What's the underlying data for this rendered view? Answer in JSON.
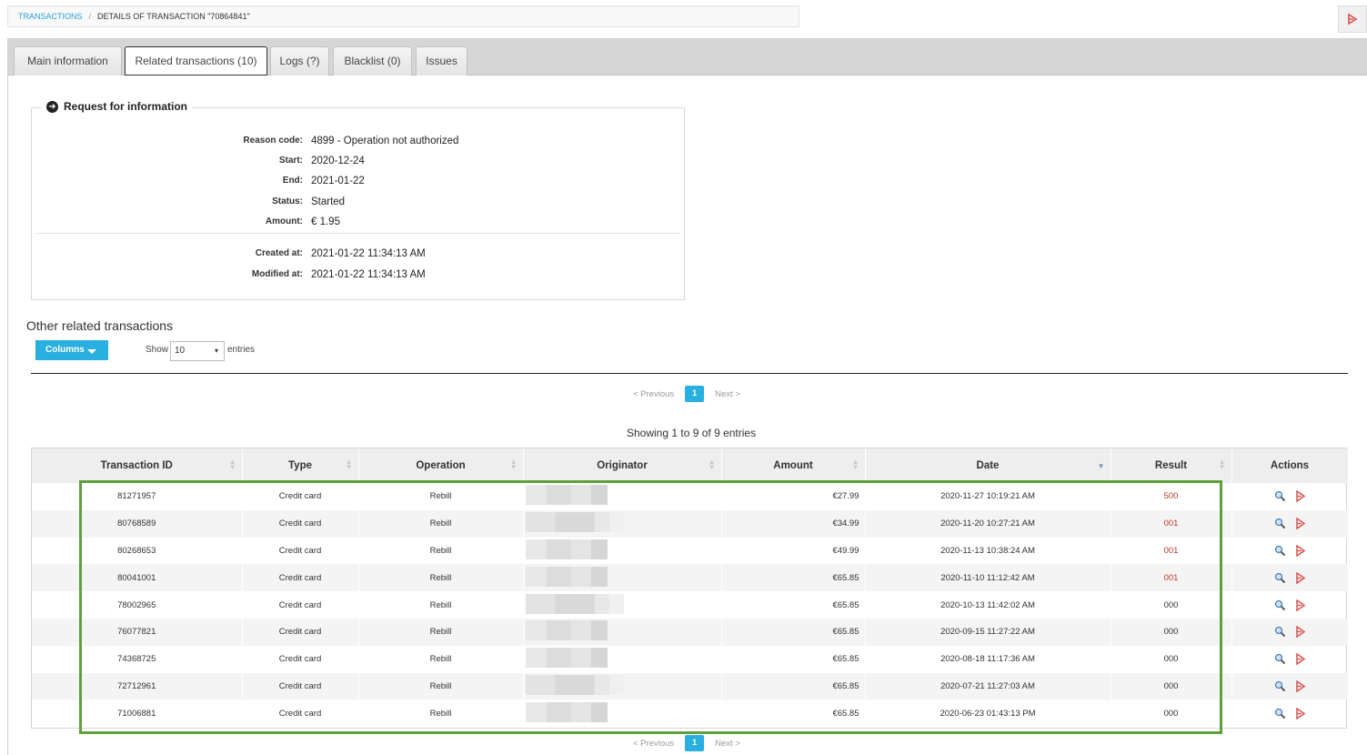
{
  "breadcrumb": {
    "root": "TRANSACTIONS",
    "separator": "/",
    "current": "DETAILS OF TRANSACTION \"70864841\""
  },
  "tabs": [
    {
      "label": "Main information"
    },
    {
      "label": "Related transactions (10)",
      "active": true
    },
    {
      "label": "Logs (?)"
    },
    {
      "label": "Blacklist (0)"
    },
    {
      "label": "Issues"
    }
  ],
  "request_info": {
    "legend": "Request for information",
    "fields": [
      {
        "label": "Reason code:",
        "value": "4899 - Operation not authorized"
      },
      {
        "label": "Start:",
        "value": "2020-12-24"
      },
      {
        "label": "End:",
        "value": "2021-01-22"
      },
      {
        "label": "Status:",
        "value": "Started"
      },
      {
        "label": "Amount:",
        "value": "€ 1.95"
      }
    ],
    "meta": [
      {
        "label": "Created at:",
        "value": "2021-01-22 11:34:13 AM"
      },
      {
        "label": "Modified at:",
        "value": "2021-01-22 11:34:13 AM"
      }
    ]
  },
  "related": {
    "title": "Other related transactions",
    "columns_button": "Columns",
    "show_label": "Show",
    "show_value": "10",
    "entries_label": "entries",
    "pager": {
      "previous": "< Previous",
      "page": "1",
      "next": "Next >"
    },
    "showing": "Showing 1 to 9 of 9 entries",
    "headers": [
      "Transaction ID",
      "Type",
      "Operation",
      "Originator",
      "Amount",
      "Date",
      "Result",
      "Actions"
    ],
    "rows": [
      {
        "id": "81271957",
        "type": "Credit card",
        "operation": "Rebill",
        "amount": "€27.99",
        "date": "2020-11-27 10:19:21 AM",
        "result": "500"
      },
      {
        "id": "80768589",
        "type": "Credit card",
        "operation": "Rebill",
        "amount": "€34.99",
        "date": "2020-11-20 10:27:21 AM",
        "result": "001"
      },
      {
        "id": "80268653",
        "type": "Credit card",
        "operation": "Rebill",
        "amount": "€49.99",
        "date": "2020-11-13 10:38:24 AM",
        "result": "001"
      },
      {
        "id": "80041001",
        "type": "Credit card",
        "operation": "Rebill",
        "amount": "€65.85",
        "date": "2020-11-10 11:12:42 AM",
        "result": "001"
      },
      {
        "id": "78002965",
        "type": "Credit card",
        "operation": "Rebill",
        "amount": "€65.85",
        "date": "2020-10-13 11:42:02 AM",
        "result": "000"
      },
      {
        "id": "76077821",
        "type": "Credit card",
        "operation": "Rebill",
        "amount": "€65.85",
        "date": "2020-09-15 11:27:22 AM",
        "result": "000"
      },
      {
        "id": "74368725",
        "type": "Credit card",
        "operation": "Rebill",
        "amount": "€65.85",
        "date": "2020-08-18 11:17:36 AM",
        "result": "000"
      },
      {
        "id": "72712961",
        "type": "Credit card",
        "operation": "Rebill",
        "amount": "€65.85",
        "date": "2020-07-21 11:27:03 AM",
        "result": "000"
      },
      {
        "id": "71006881",
        "type": "Credit card",
        "operation": "Rebill",
        "amount": "€65.85",
        "date": "2020-06-23 01:43:13 PM",
        "result": "000"
      }
    ],
    "actions_icons": [
      "magnifier-icon",
      "pdf-icon"
    ]
  },
  "colors": {
    "accent": "#2ab0e0",
    "error_result": "#c0392b",
    "highlight": "#5fa03a"
  }
}
